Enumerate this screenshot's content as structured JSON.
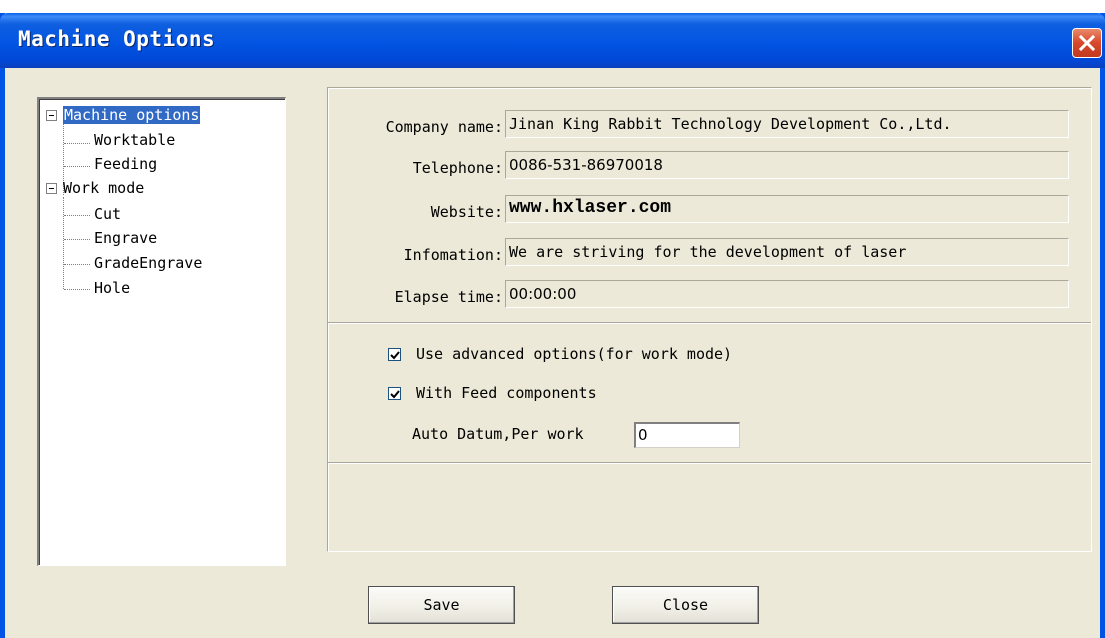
{
  "window": {
    "title": "Machine Options"
  },
  "tree": {
    "nodes": [
      {
        "label": "Machine options",
        "level": 0,
        "expanded": true,
        "selected": true
      },
      {
        "label": "Worktable",
        "level": 1
      },
      {
        "label": "Feeding",
        "level": 1
      },
      {
        "label": "Work mode",
        "level": 0,
        "expanded": true
      },
      {
        "label": "Cut",
        "level": 1
      },
      {
        "label": "Engrave",
        "level": 1
      },
      {
        "label": "GradeEngrave",
        "level": 1
      },
      {
        "label": "Hole",
        "level": 1
      }
    ]
  },
  "info": {
    "company_label": "Company name:",
    "company_value": "Jinan King Rabbit Technology Development Co.,Ltd.",
    "telephone_label": "Telephone:",
    "telephone_value": "0086-531-86970018",
    "website_label": "Website:",
    "website_value": "www.hxlaser.com",
    "information_label": "Infomation:",
    "information_value": "We are striving for the development of laser",
    "elapse_label": "Elapse time:",
    "elapse_value": "00:00:00"
  },
  "options": {
    "advanced_label": "Use advanced options(for work mode)",
    "advanced_checked": true,
    "feed_label": "With Feed components",
    "feed_checked": true,
    "datum_label": "Auto Datum,Per work",
    "datum_value": "0"
  },
  "buttons": {
    "save": "Save",
    "close": "Close"
  },
  "colors": {
    "titlebar": "#0054e3",
    "selection": "#316ac5",
    "dialog_bg": "#ece9d8",
    "close_button": "#d8472b"
  }
}
